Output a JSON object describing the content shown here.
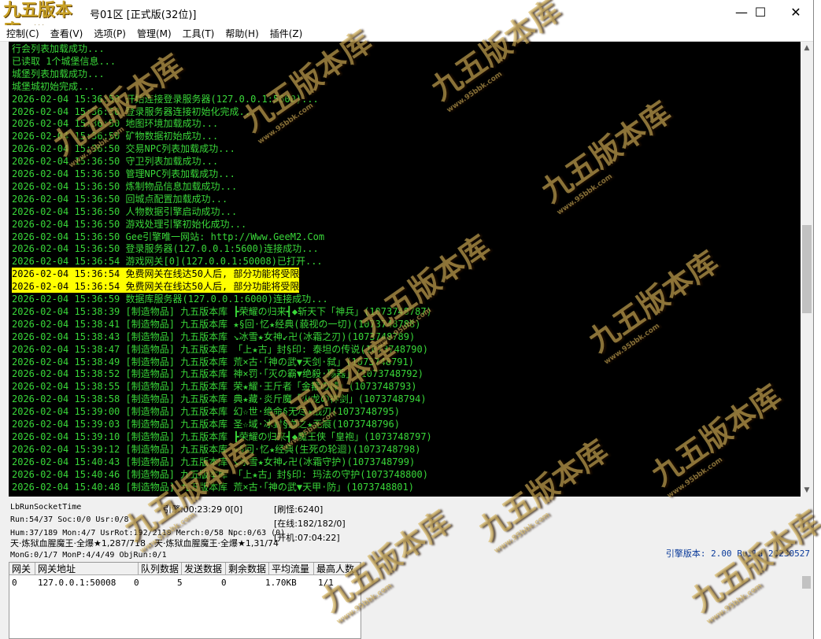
{
  "window": {
    "title": "号01区 [正式版(32位)]",
    "logo": "九五版本库",
    "logo_sub": "www.95bbk.com",
    "controls": {
      "minimize": "—",
      "maximize": "☐",
      "close": "✕"
    }
  },
  "menu": [
    "控制(C)",
    "查看(V)",
    "选项(P)",
    "管理(M)",
    "工具(T)",
    "帮助(H)",
    "插件(Z)"
  ],
  "log": [
    {
      "text": "行会列表加载成功...",
      "hl": false
    },
    {
      "text": "已读取 1个城堡信息...",
      "hl": false
    },
    {
      "text": "城堡列表加载成功...",
      "hl": false
    },
    {
      "text": "城堡城初始完成...",
      "hl": false
    },
    {
      "text": "2026-02-04 15:36:50 开始连接登录服务器(127.0.0.1:5600)...",
      "hl": false
    },
    {
      "text": "2026-02-04 15:36:50 登录服务器连接初始化完成...",
      "hl": false
    },
    {
      "text": "2026-02-04 15:36:50 地图环境加载成功...",
      "hl": false
    },
    {
      "text": "2026-02-04 15:36:50 矿物数据初始成功...",
      "hl": false
    },
    {
      "text": "2026-02-04 15:36:50 交易NPC列表加载成功...",
      "hl": false
    },
    {
      "text": "2026-02-04 15:36:50 守卫列表加载成功...",
      "hl": false
    },
    {
      "text": "2026-02-04 15:36:50 管理NPC列表加载成功...",
      "hl": false
    },
    {
      "text": "2026-02-04 15:36:50 炼制物品信息加载成功...",
      "hl": false
    },
    {
      "text": "2026-02-04 15:36:50 回城点配置加载成功...",
      "hl": false
    },
    {
      "text": "2026-02-04 15:36:50 人物数据引擎启动成功...",
      "hl": false
    },
    {
      "text": "2026-02-04 15:36:50 游戏处理引擎初始化成功...",
      "hl": false
    },
    {
      "text": "2026-02-04 15:36:50 Gee引擎唯一网站: http://Www.GeeM2.Com",
      "hl": false
    },
    {
      "text": "2026-02-04 15:36:50 登录服务器(127.0.0.1:5600)连接成功...",
      "hl": false
    },
    {
      "text": "2026-02-04 15:36:54 游戏网关[0](127.0.0.1:50008)已打开...",
      "hl": false
    },
    {
      "text": "2026-02-04 15:36:54 免费网关在线达50人后, 部分功能将受限",
      "hl": true
    },
    {
      "text": "2026-02-04 15:36:54 免费网关在线达50人后, 部分功能将受限",
      "hl": true
    },
    {
      "text": "2026-02-04 15:36:59 数据库服务器(127.0.0.1:6000)连接成功...",
      "hl": false
    },
    {
      "text": "2026-02-04 15:38:39 [制造物品] 九五版本库 ┣荣耀の归来┫◆斩天下「神兵」(1073748787)",
      "hl": false
    },
    {
      "text": "2026-02-04 15:38:41 [制造物品] 九五版本库 ★§回·忆★经典(藐视の一切)(1073748788)",
      "hl": false
    },
    {
      "text": "2026-02-04 15:38:43 [制造物品] 九五版本库 ↘冰雪★女神↙卍(冰霜之刃)(1073748789)",
      "hl": false
    },
    {
      "text": "2026-02-04 15:38:47 [制造物品] 九五版本库 「上★古」封§印: 泰坦の传说(1073748790)",
      "hl": false
    },
    {
      "text": "2026-02-04 15:38:49 [制造物品] 九五版本库 荒×古·「神の武▼天剑·弑」(1073748791)",
      "hl": false
    },
    {
      "text": "2026-02-04 15:38:52 [制造物品] 九五版本库 神×罚·「灭の霸▼绝殺·殇器」(1073748792)",
      "hl": false
    },
    {
      "text": "2026-02-04 15:38:55 [制造物品] 九五版本库 荣★耀·王斤者「金箍の棒」(1073748793)",
      "hl": false
    },
    {
      "text": "2026-02-04 15:38:58 [制造物品] 九五版本库 典★藏·炎斤魔「火龙の神剑」(1073748794)",
      "hl": false
    },
    {
      "text": "2026-02-04 15:39:00 [制造物品] 九五版本库 幻☆世·绝命§无尽★战刃(1073748795)",
      "hl": false
    },
    {
      "text": "2026-02-04 15:39:03 [制造物品] 九五版本库 圣☆域·冰封§血之★无痕(1073748796)",
      "hl": false
    },
    {
      "text": "2026-02-04 15:39:10 [制造物品] 九五版本库 ┣荣耀の归来┫◆魔王侠「皇袍」(1073748797)",
      "hl": false
    },
    {
      "text": "2026-02-04 15:39:12 [制造物品] 九五版本库 ★§回·忆★经典(生死の轮迴)(1073748798)",
      "hl": false
    },
    {
      "text": "2026-02-04 15:40:43 [制造物品] 九五版本库 ↘冰雪★女神↙卍(冰霜守护)(1073748799)",
      "hl": false
    },
    {
      "text": "2026-02-04 15:40:46 [制造物品] 九五版本库 「上★古」封§印: 玛法の守护(1073748800)",
      "hl": false
    },
    {
      "text": "2026-02-04 15:40:48 [制造物品] 九五版本库 荒×古·「神の武▼天甲·防」(1073748801)",
      "hl": false
    }
  ],
  "status": {
    "socket_time": "LbRunSocketTime",
    "run": "Run:54/37 Soc:0/0 Usr:0/8",
    "engine_time": "引擎:00:23:29 0[0]",
    "refresh": "[刷怪:6240]",
    "online": "[在线:182/182/0]",
    "hum": "Hum:37/189 Mon:4/7 UsrRot:192/2110 Merch:0/58 Npc:0/63 (0)",
    "boot": "[开机:07:04:22]",
    "broadcast": "天·炼狱血腥魔王·全爆★1,287/718 - 天·炼狱血腥魔王·全爆★1,31/74",
    "mon": "MonG:0/1/7 MonP:4/4/49 ObjRun:0/1",
    "version": "引擎版本: 2.00 Build 20230527"
  },
  "gateway": {
    "headers": [
      "网关",
      "网关地址",
      "队列数据",
      "发送数据",
      "剩余数据",
      "平均流量",
      "最高人数"
    ],
    "rows": [
      [
        "0",
        "127.0.0.1:50008",
        "0",
        "5",
        "0",
        "1.70KB",
        "1/1"
      ]
    ]
  },
  "watermark": {
    "text": "九五版本库",
    "sub": "www.95bbk.com"
  }
}
